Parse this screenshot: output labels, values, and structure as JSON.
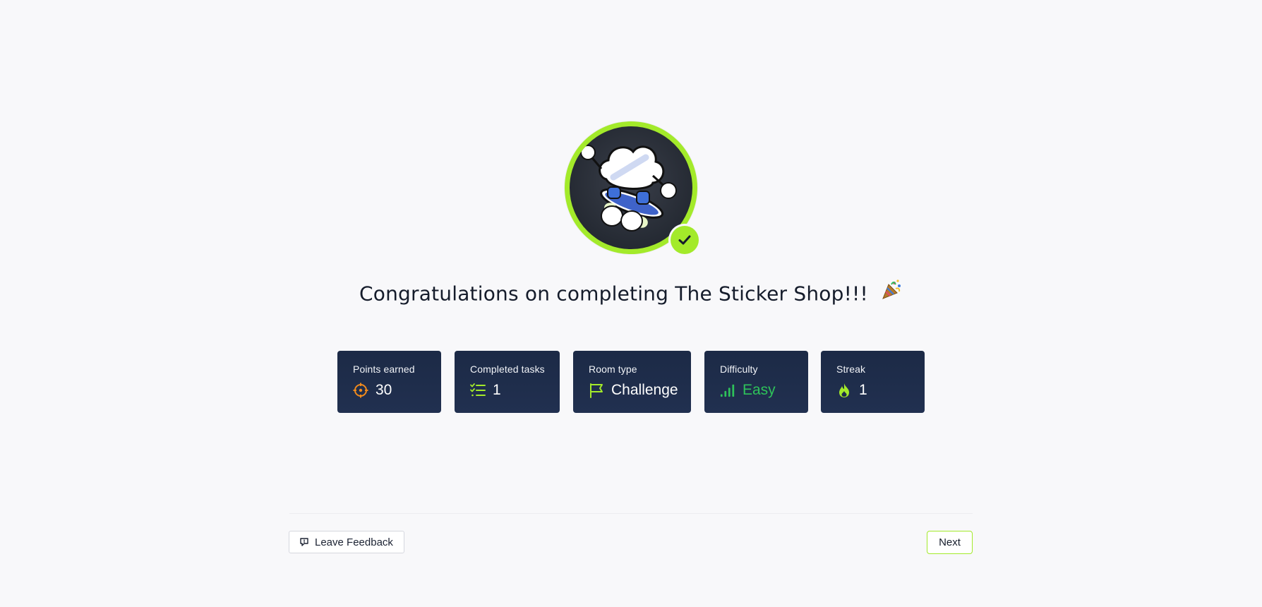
{
  "completion": {
    "title": "Congratulations on completing The Sticker Shop!!!",
    "title_emoji_icon": "party-popper-icon",
    "badge_icon": "cloud-skateboard-mascot-icon",
    "badge_status_icon": "checkmark-icon"
  },
  "stats": [
    {
      "label": "Points earned",
      "value": "30",
      "icon": "crosshair-icon",
      "icon_color": "#f08a1c"
    },
    {
      "label": "Completed tasks",
      "value": "1",
      "icon": "checklist-icon",
      "icon_color": "#a3ea2a"
    },
    {
      "label": "Room type",
      "value": "Challenge",
      "icon": "flag-icon",
      "icon_color": "#a3ea2a"
    },
    {
      "label": "Difficulty",
      "value": "Easy",
      "icon": "signal-bars-icon",
      "icon_color": "#2ec25a"
    },
    {
      "label": "Streak",
      "value": "1",
      "icon": "flame-icon",
      "icon_color": "#a3ea2a"
    }
  ],
  "footer": {
    "feedback_label": "Leave Feedback",
    "next_label": "Next"
  },
  "colors": {
    "accent": "#a3ea2a",
    "card_bg": "#1f2d4b",
    "page_bg": "#f8f8fa",
    "easy": "#2ec25a",
    "points": "#f08a1c"
  }
}
